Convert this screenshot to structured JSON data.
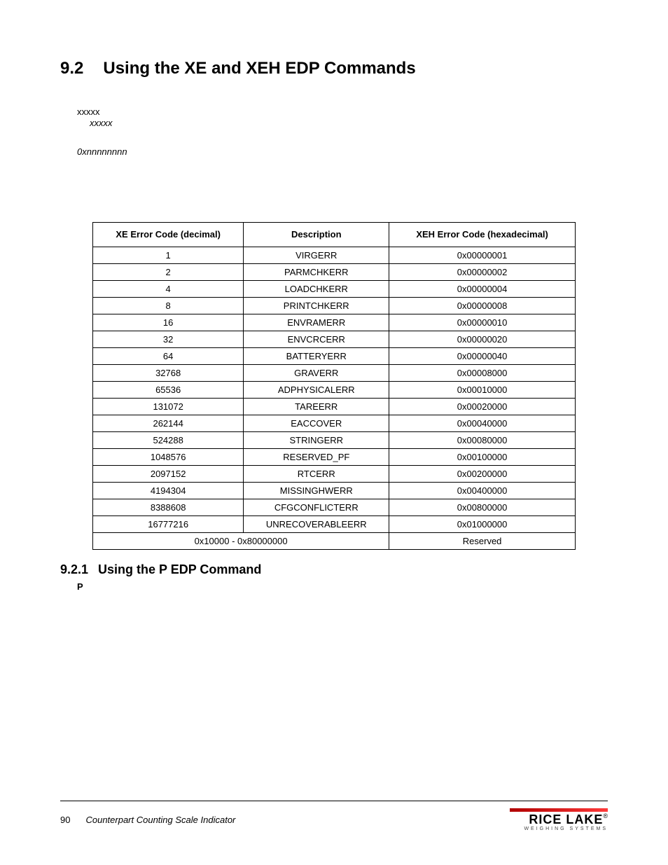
{
  "section": {
    "number": "9.2",
    "title": "Using the XE and XEH EDP Commands"
  },
  "body": {
    "x1": "xxxxx",
    "x2": "xxxxx",
    "hex": "0xnnnnnnnn"
  },
  "table": {
    "headers": [
      "XE Error Code (decimal)",
      "Description",
      "XEH Error Code (hexadecimal)"
    ],
    "rows": [
      [
        "1",
        "VIRGERR",
        "0x00000001"
      ],
      [
        "2",
        "PARMCHKERR",
        "0x00000002"
      ],
      [
        "4",
        "LOADCHKERR",
        "0x00000004"
      ],
      [
        "8",
        "PRINTCHKERR",
        "0x00000008"
      ],
      [
        "16",
        "ENVRAMERR",
        "0x00000010"
      ],
      [
        "32",
        "ENVCRCERR",
        "0x00000020"
      ],
      [
        "64",
        "BATTERYERR",
        "0x00000040"
      ],
      [
        "32768",
        "GRAVERR",
        "0x00008000"
      ],
      [
        "65536",
        "ADPHYSICALERR",
        "0x00010000"
      ],
      [
        "131072",
        "TAREERR",
        "0x00020000"
      ],
      [
        "262144",
        "EACCOVER",
        "0x00040000"
      ],
      [
        "524288",
        "STRINGERR",
        "0x00080000"
      ],
      [
        "1048576",
        "RESERVED_PF",
        "0x00100000"
      ],
      [
        "2097152",
        "RTCERR",
        "0x00200000"
      ],
      [
        "4194304",
        "MISSINGHWERR",
        "0x00400000"
      ],
      [
        "8388608",
        "CFGCONFLICTERR",
        "0x00800000"
      ],
      [
        "16777216",
        "UNRECOVERABLEERR",
        "0x01000000"
      ]
    ],
    "reserved": [
      "0x10000 - 0x80000000",
      "Reserved"
    ]
  },
  "subsection": {
    "number": "9.2.1",
    "title": "Using the P EDP Command",
    "line": "P"
  },
  "footer": {
    "page": "90",
    "title": "Counterpart Counting Scale Indicator",
    "logo_main": "RICE LAKE",
    "logo_sub": "WEIGHING SYSTEMS"
  }
}
